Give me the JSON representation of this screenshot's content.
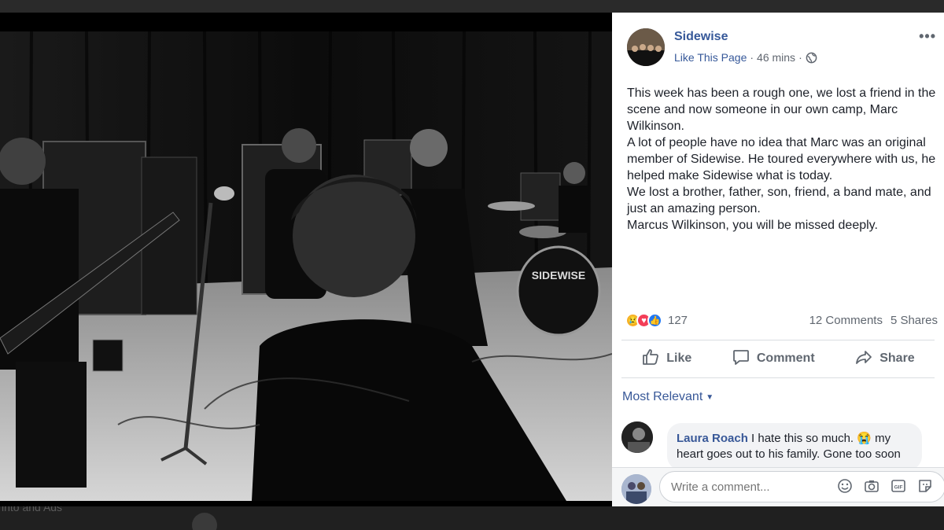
{
  "backdrop": {
    "bottom_text": "into and Ads"
  },
  "post": {
    "page_name": "Sidewise",
    "like_page": "Like This Page",
    "separator": "·",
    "time": "46 mins",
    "text_lines": [
      "This week has been a rough one, we lost a friend in the scene and now someone in our own camp, Marc Wilkinson.",
      "A lot of people have no idea that Marc was an original member of Sidewise. He toured everywhere with us, he helped make Sidewise what is today.",
      "We lost a brother, father, son, friend, a band mate, and just an amazing person.",
      "Marcus Wilkinson, you will be missed deeply."
    ],
    "reaction_count": "127",
    "comments_count": "12 Comments",
    "shares_count": "5 Shares"
  },
  "actions": {
    "like": "Like",
    "comment": "Comment",
    "share": "Share"
  },
  "sort": {
    "label": "Most Relevant"
  },
  "comment": {
    "author": "Laura Roach",
    "text": " I hate this so much. 😭 my heart goes out to his family. Gone too soon"
  },
  "composer": {
    "placeholder": "Write a comment..."
  },
  "photo": {
    "drum_logo": "SIDEWISE"
  },
  "colors": {
    "link": "#365899",
    "text": "#1d2129",
    "muted": "#606770"
  },
  "icons": [
    "more-icon",
    "globe-icon",
    "like-icon",
    "comment-icon",
    "share-icon",
    "emoji-icon",
    "camera-icon",
    "gif-icon",
    "sticker-icon"
  ]
}
